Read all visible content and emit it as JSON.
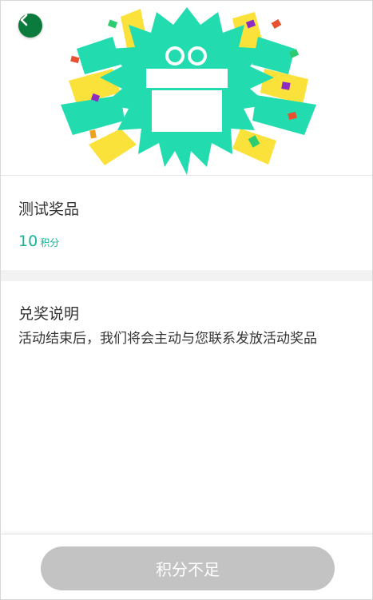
{
  "header": {
    "back_icon": "chevron-left-icon",
    "banner_icon": "gift-icon",
    "accent_color": "#22dcb0",
    "back_color": "#0b7a3d"
  },
  "prize": {
    "name": "测试奖品",
    "points": "10",
    "points_unit": "积分",
    "accent_color": "#16b394"
  },
  "rules": {
    "title": "兑奖说明",
    "text": "活动结束后，我们将会主动与您联系发放活动奖品"
  },
  "footer": {
    "button_label": "积分不足",
    "button_color": "#c3c3c3"
  }
}
